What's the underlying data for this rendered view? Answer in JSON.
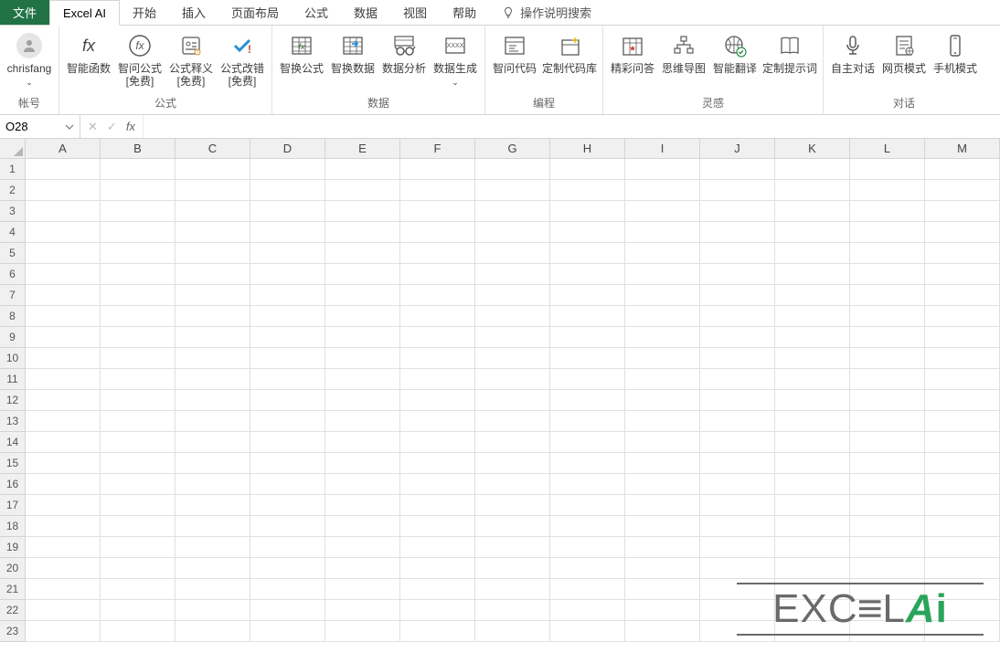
{
  "tabs": {
    "file": "文件",
    "active": "Excel AI",
    "items": [
      "开始",
      "插入",
      "页面布局",
      "公式",
      "数据",
      "视图",
      "帮助"
    ],
    "tell_me": "操作说明搜索"
  },
  "ribbon": {
    "account": {
      "user": "chrisfang",
      "group": "帐号"
    },
    "fx_single": {
      "label": "智能函数"
    },
    "formula": {
      "group": "公式",
      "items": [
        {
          "label": "智问公式\n[免费]"
        },
        {
          "label": "公式释义\n[免费]"
        },
        {
          "label": "公式改错\n[免费]"
        }
      ]
    },
    "data": {
      "group": "数据",
      "items": [
        {
          "label": "智换公式"
        },
        {
          "label": "智换数据"
        },
        {
          "label": "数据分析"
        },
        {
          "label": "数据生成"
        }
      ]
    },
    "coding": {
      "group": "编程",
      "items": [
        {
          "label": "智问代码"
        },
        {
          "label": "定制代码库"
        }
      ]
    },
    "inspire": {
      "group": "灵感",
      "items": [
        {
          "label": "精彩问答"
        },
        {
          "label": "思维导图"
        },
        {
          "label": "智能翻译"
        },
        {
          "label": "定制提示词"
        }
      ]
    },
    "dialog": {
      "group": "对话",
      "items": [
        {
          "label": "自主对话"
        },
        {
          "label": "网页模式"
        },
        {
          "label": "手机模式"
        }
      ]
    }
  },
  "formula_bar": {
    "name_box": "O28",
    "cancel": "✕",
    "enter": "✓",
    "fx": "fx",
    "value": ""
  },
  "grid": {
    "cols": [
      "A",
      "B",
      "C",
      "D",
      "E",
      "F",
      "G",
      "H",
      "I",
      "J",
      "K",
      "L",
      "M"
    ],
    "rows": [
      "1",
      "2",
      "3",
      "4",
      "5",
      "6",
      "7",
      "8",
      "9",
      "10",
      "11",
      "12",
      "13",
      "14",
      "15",
      "16",
      "17",
      "18",
      "19",
      "20",
      "21",
      "22",
      "23"
    ]
  },
  "watermark": {
    "text_main": "EXC",
    "text_e": "E",
    "text_l": "L",
    "text_a": "A",
    "text_i": "i"
  }
}
